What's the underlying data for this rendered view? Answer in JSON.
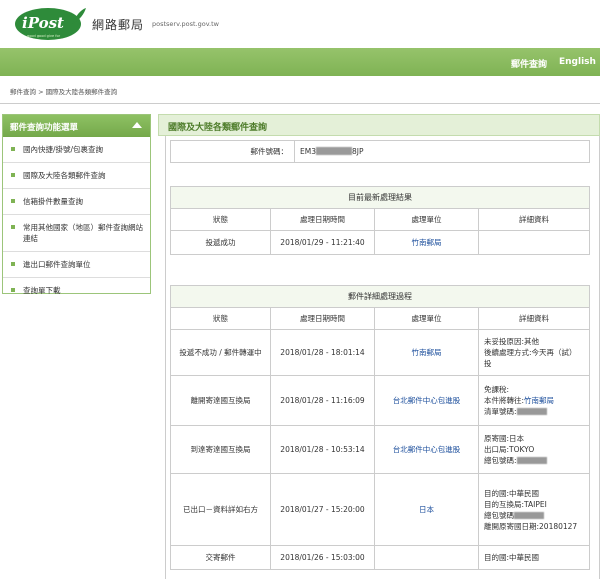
{
  "header": {
    "logo_text": "iPost",
    "logo_tagline": "good good give for",
    "site_name": "網路郵局",
    "site_url": "postserv.post.gov.tw"
  },
  "navbar": {
    "items": [
      "郵件查詢",
      "English"
    ]
  },
  "breadcrumb": "郵件查詢 > 國際及大陸各類郵件查詢",
  "sidebar": {
    "title": "郵件查詢功能選單",
    "items": [
      {
        "label": "國內快捷/掛號/包裹查詢"
      },
      {
        "label": "國際及大陸各類郵件查詢"
      },
      {
        "label": "信箱掛件數量查詢"
      },
      {
        "label": "常用其他國家（地區）郵件查詢網站連結"
      },
      {
        "label": "進出口郵件查詢單位"
      },
      {
        "label": "查詢單下載"
      }
    ]
  },
  "main": {
    "title": "國際及大陸各類郵件查詢",
    "mail_number_label": "郵件號碼：",
    "mail_number_prefix": "EM3",
    "mail_number_suffix": "8JP"
  },
  "latest": {
    "section_title": "目前最新處理結果",
    "columns": [
      "狀態",
      "處理日期時間",
      "處理單位",
      "詳細資料"
    ],
    "row": {
      "status": "投遞成功",
      "datetime": "2018/01/29 - 11:21:40",
      "unit": "竹南郵局",
      "details": ""
    }
  },
  "detail": {
    "section_title": "郵件詳細處理過程",
    "columns": [
      "狀態",
      "處理日期時間",
      "處理單位",
      "詳細資料"
    ],
    "rows": [
      {
        "status": "投遞不成功 / 郵件轉運中",
        "datetime": "2018/01/28 - 18:01:14",
        "unit": "竹南郵局",
        "details": [
          "未妥投原因:其他",
          "後續處理方式:今天再（試）投"
        ]
      },
      {
        "status": "離開寄達國互換局",
        "datetime": "2018/01/28 - 11:16:09",
        "unit": "台北郵件中心包進股",
        "details_1": "免課稅:",
        "details_2a": "本件將轉往:",
        "details_2b": "竹南郵局",
        "details_3": "清單號碼:"
      },
      {
        "status": "到達寄達國互換局",
        "datetime": "2018/01/28 - 10:53:14",
        "unit": "台北郵件中心包進股",
        "details": [
          "原寄國:日本",
          "出口局:TOKYO",
          "總包號碼:"
        ]
      },
      {
        "status": "已出口－資料詳如右方",
        "datetime": "2018/01/27 - 15:20:00",
        "unit": "日本",
        "details": [
          "目的國:中華民國",
          "目的互換局:TAIPEI",
          "總包號碼",
          "離開原寄國日期:20180127"
        ]
      },
      {
        "status": "交寄郵件",
        "datetime": "2018/01/26 - 15:03:00",
        "unit": "",
        "details": [
          "目的國:中華民國"
        ]
      }
    ]
  },
  "colors": {
    "brand_green": "#7fb354",
    "link_blue": "#1d4f9c"
  }
}
